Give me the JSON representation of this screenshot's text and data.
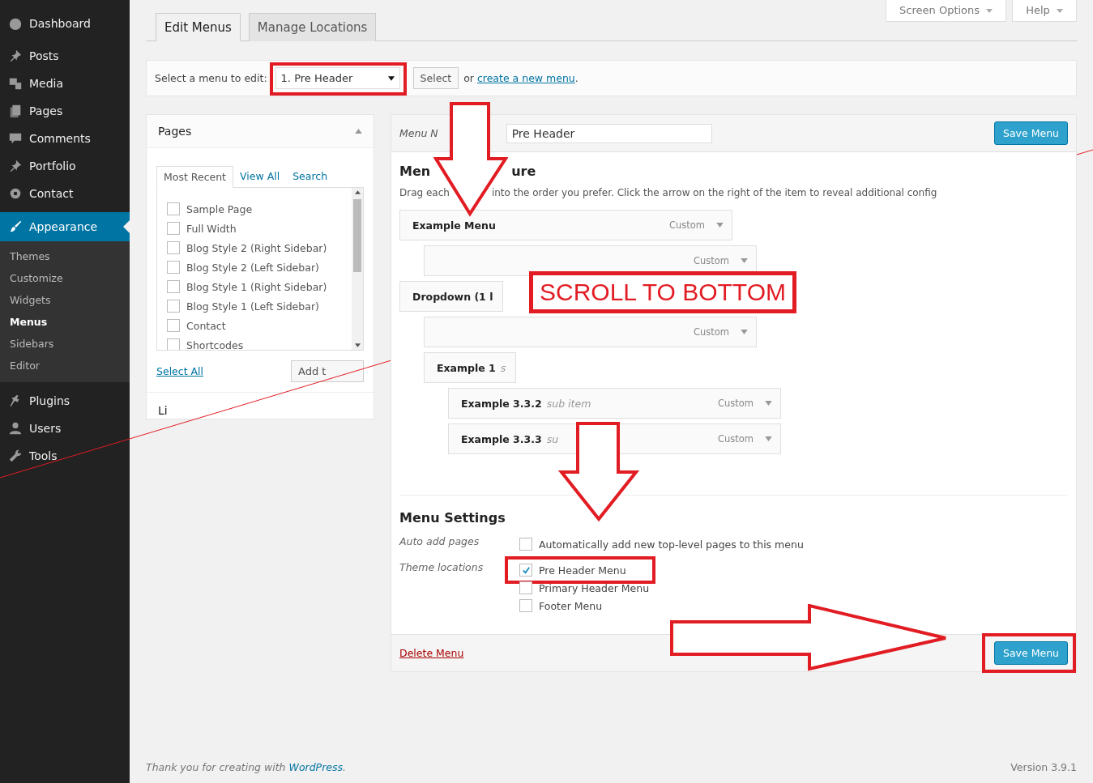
{
  "sidebar": {
    "items": [
      {
        "label": "Dashboard",
        "selected": false
      },
      {
        "label": "Posts",
        "selected": false
      },
      {
        "label": "Media",
        "selected": false
      },
      {
        "label": "Pages",
        "selected": false
      },
      {
        "label": "Comments",
        "selected": false
      },
      {
        "label": "Portfolio",
        "selected": false
      },
      {
        "label": "Contact",
        "selected": false
      },
      {
        "label": "Appearance",
        "selected": true,
        "children": [
          {
            "label": "Themes",
            "selected": false
          },
          {
            "label": "Customize",
            "selected": false
          },
          {
            "label": "Widgets",
            "selected": false
          },
          {
            "label": "Menus",
            "selected": true
          },
          {
            "label": "Sidebars",
            "selected": false
          },
          {
            "label": "Editor",
            "selected": false
          }
        ]
      },
      {
        "label": "Plugins",
        "selected": false
      },
      {
        "label": "Users",
        "selected": false
      },
      {
        "label": "Tools",
        "selected": false
      }
    ]
  },
  "top_buttons": [
    "Screen Options",
    "Help"
  ],
  "tabs": [
    {
      "label": "Edit Menus",
      "selected": true
    },
    {
      "label": "Manage Locations",
      "selected": false
    }
  ],
  "select_bar": {
    "label": "Select a menu to edit:",
    "value": "1. Pre Header",
    "button": "Select",
    "or": "or",
    "link": "create a new menu",
    "after": "."
  },
  "pages_panel": {
    "title": "Pages",
    "tabs": [
      {
        "label": "Most Recent",
        "selected": true
      },
      {
        "label": "View All",
        "selected": false
      },
      {
        "label": "Search",
        "selected": false
      }
    ],
    "items": [
      {
        "label": "Sample Page",
        "checked": false
      },
      {
        "label": "Full Width",
        "checked": false
      },
      {
        "label": "Blog Style 2 (Right Sidebar)",
        "checked": false
      },
      {
        "label": "Blog Style 2 (Left Sidebar)",
        "checked": false
      },
      {
        "label": "Blog Style 1 (Right Sidebar)",
        "checked": false
      },
      {
        "label": "Blog Style 1 (Left Sidebar)",
        "checked": false
      },
      {
        "label": "Contact",
        "checked": false
      },
      {
        "label": "Shortcodes",
        "checked": false
      }
    ],
    "select_all": "Select All",
    "add_button": "Add t",
    "next_section": "Li"
  },
  "menu_panel": {
    "name_label": "Menu N",
    "name_value": "Pre Header",
    "save": "Save Menu",
    "heading": [
      "Men",
      "ure"
    ],
    "description": [
      "Drag each",
      "into the order you prefer. Click the arrow on the right of the item to reveal additional config"
    ],
    "items": [
      {
        "title": "Example Menu",
        "type": "Custom",
        "children": [
          {
            "type": "Custom"
          }
        ]
      },
      {
        "title": "Dropdown (1 l",
        "children": [
          {
            "type": "Custom"
          },
          {
            "title": "Example 1",
            "sub": "s",
            "children": [
              {
                "title": "Example 3.3.2",
                "sub": "sub item",
                "type": "Custom"
              },
              {
                "title": "Example 3.3.3",
                "sub": "su",
                "type": "Custom"
              }
            ]
          }
        ]
      }
    ],
    "settings_heading": "Menu Settings",
    "settings": [
      {
        "label": "Auto add pages",
        "options": [
          {
            "label": "Automatically add new top-level pages to this menu",
            "checked": false,
            "highlighted": false
          }
        ]
      },
      {
        "label": "Theme locations",
        "options": [
          {
            "label": "Pre Header Menu",
            "checked": true,
            "highlighted": true
          },
          {
            "label": "Primary Header Menu",
            "checked": false,
            "highlighted": false
          },
          {
            "label": "Footer Menu",
            "checked": false,
            "highlighted": false
          }
        ]
      }
    ],
    "delete": "Delete Menu",
    "save_bottom": "Save Menu"
  },
  "annotations": {
    "callout": "SCROLL TO BOTTOM"
  },
  "footer": {
    "text": "Thank you for creating with ",
    "link": "WordPress",
    "after": ".",
    "version": "Version 3.9.1"
  }
}
